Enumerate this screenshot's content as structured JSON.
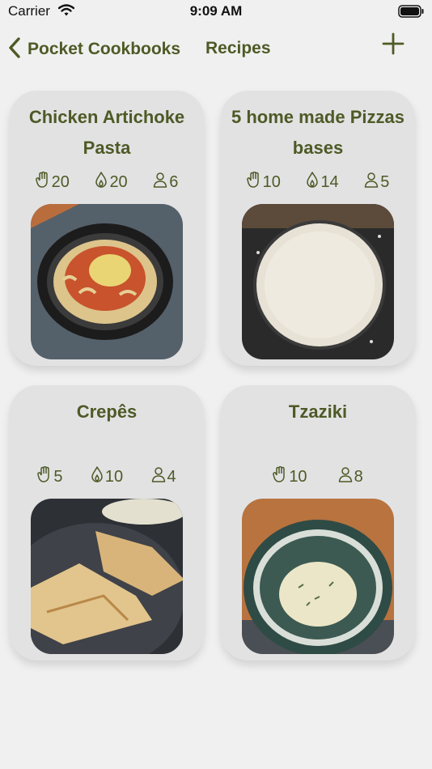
{
  "status_bar": {
    "carrier": "Carrier",
    "time": "9:09 AM"
  },
  "nav": {
    "back_label": "Pocket Cookbooks",
    "title": "Recipes"
  },
  "recipes": [
    {
      "title": "Chicken Artichoke Pasta",
      "prep": "20",
      "cook": "20",
      "servings": "6",
      "image": "pasta-photo"
    },
    {
      "title": "5 home made Pizzas bases",
      "prep": "10",
      "cook": "14",
      "servings": "5",
      "image": "pizza-dough-photo"
    },
    {
      "title": "Crepês",
      "prep": "5",
      "cook": "10",
      "servings": "4",
      "image": "crepes-photo"
    },
    {
      "title": "Tzaziki",
      "prep": "10",
      "servings": "8",
      "image": "tzatziki-photo"
    }
  ],
  "colors": {
    "accent": "#4e5a26",
    "card": "#e2e2e3",
    "background": "#f0f0f0"
  }
}
